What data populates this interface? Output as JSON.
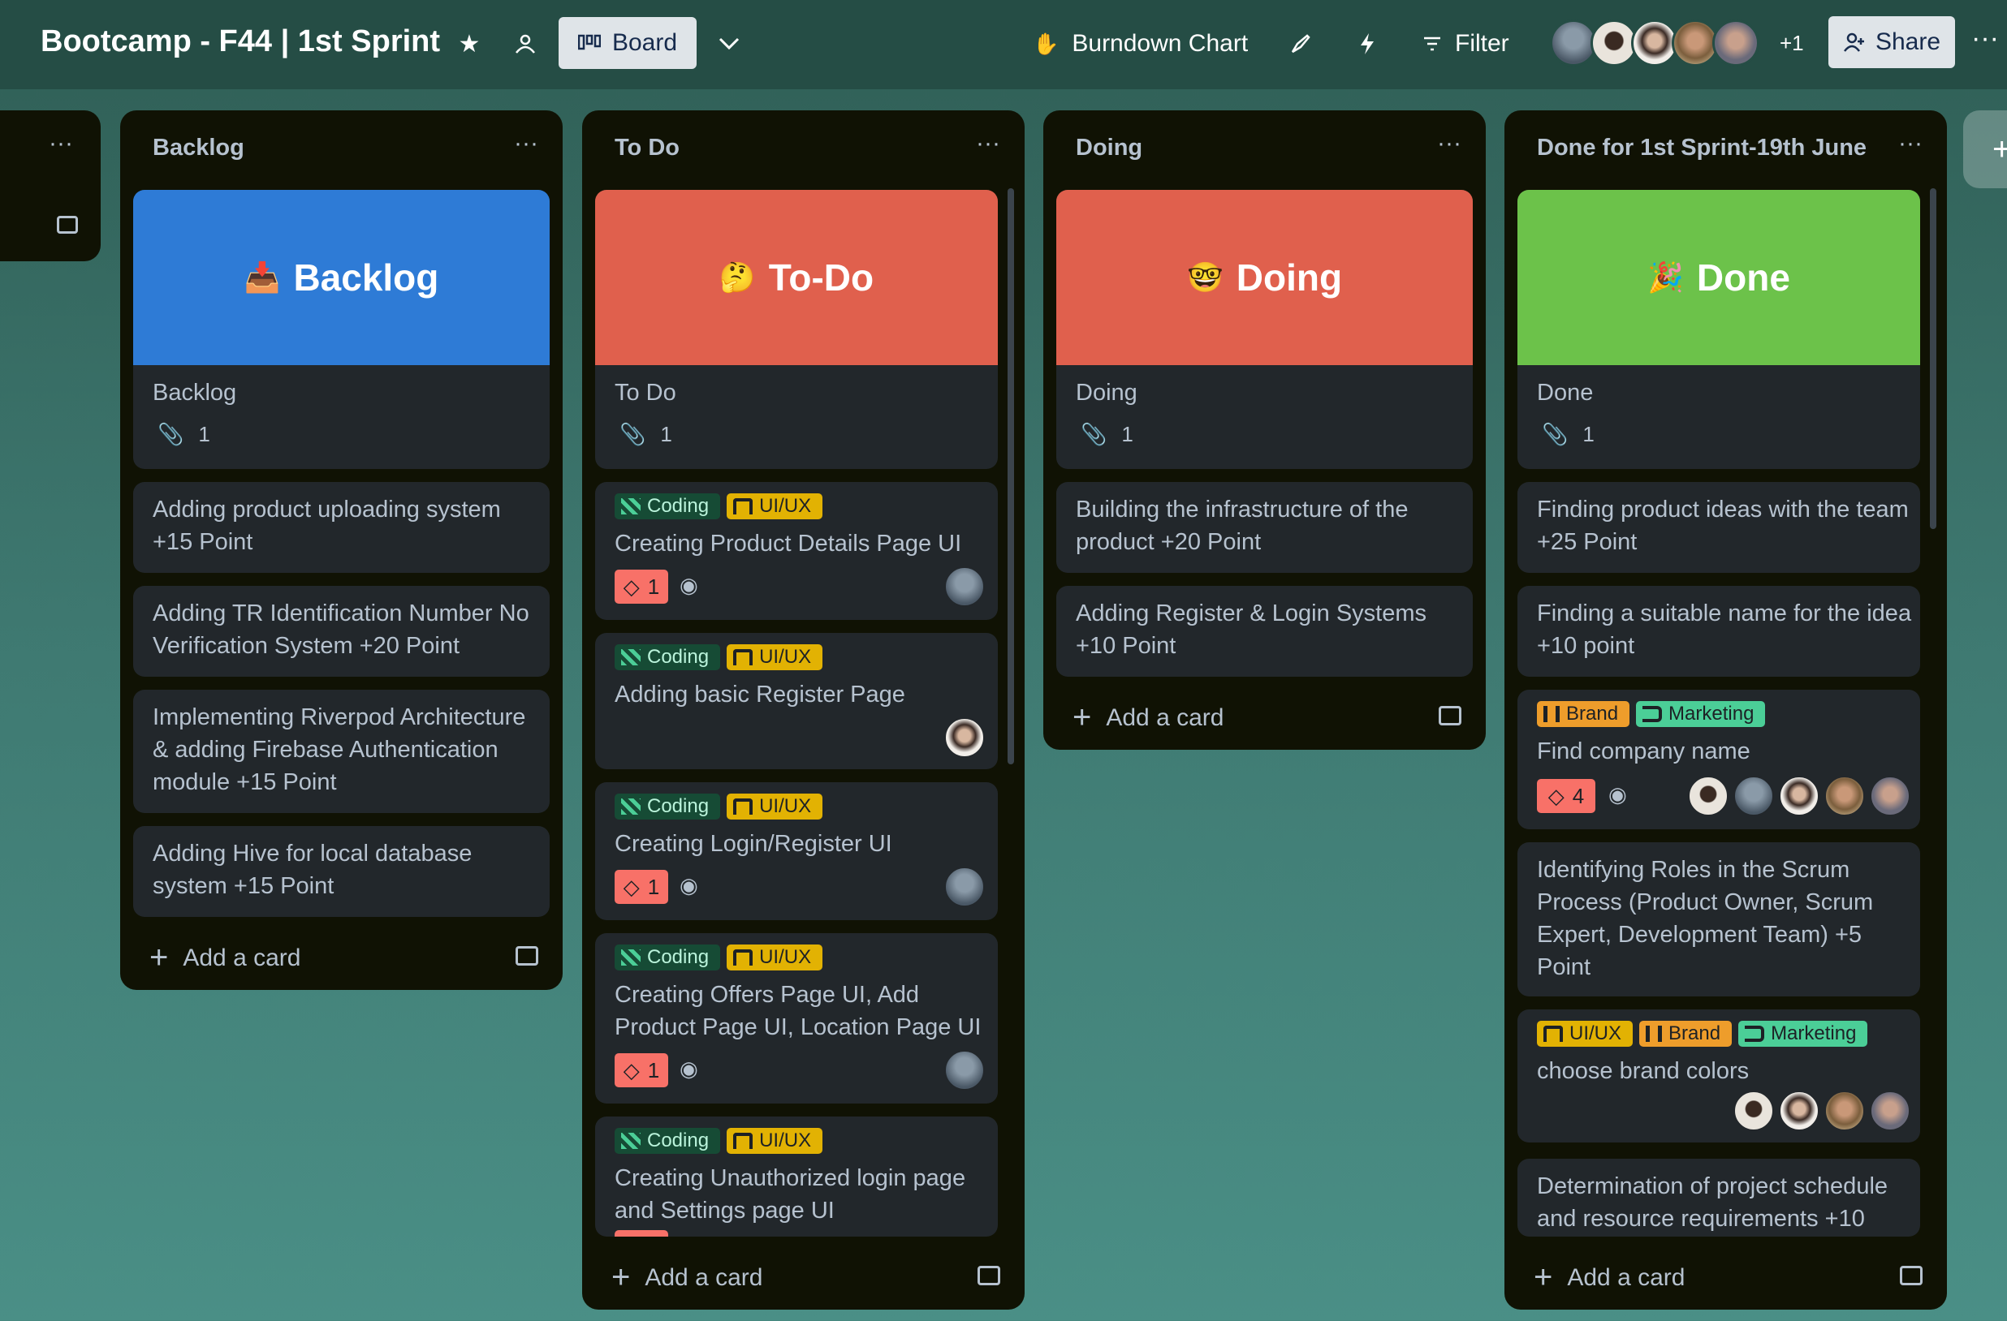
{
  "topbar": {
    "board_title": "Bootcamp - F44 | 1st Sprint",
    "board_view_label": "Board",
    "burndown_label": "Burndown Chart",
    "filter_label": "Filter",
    "extra_members": "+1",
    "share_label": "Share"
  },
  "lists": [
    {
      "title": "Backlog",
      "cover": {
        "emoji": "📥",
        "title": "Backlog",
        "color": "#2e7bd6"
      },
      "cover_card_title": "Backlog",
      "attachments": "1",
      "cards": [
        {
          "text": "Adding product uploading system +15 Point"
        },
        {
          "text": "Adding TR Identification Number No Verification System +20 Point"
        },
        {
          "text": "Implementing Riverpod Architecture & adding Firebase Authentication module +15 Point"
        },
        {
          "text": "Adding Hive for local database system +15 Point"
        }
      ],
      "add_card": "Add a card"
    },
    {
      "title": "To Do",
      "cover": {
        "emoji": "🤔",
        "title": "To-Do",
        "color": "#e0604d"
      },
      "cover_card_title": "To Do",
      "attachments": "1",
      "cards": [
        {
          "labels": [
            "Coding",
            "UI/UX"
          ],
          "text": "Creating Product Details Page UI",
          "badge": "1"
        },
        {
          "labels": [
            "Coding",
            "UI/UX"
          ],
          "text": "Adding basic Register Page"
        },
        {
          "labels": [
            "Coding",
            "UI/UX"
          ],
          "text": "Creating Login/Register UI",
          "badge": "1"
        },
        {
          "labels": [
            "Coding",
            "UI/UX"
          ],
          "text": "Creating Offers Page UI, Add Product Page UI, Location Page UI",
          "badge": "1"
        },
        {
          "labels": [
            "Coding",
            "UI/UX"
          ],
          "text": "Creating Unauthorized login page and Settings page UI"
        }
      ],
      "add_card": "Add a card"
    },
    {
      "title": "Doing",
      "cover": {
        "emoji": "🤓",
        "title": "Doing",
        "color": "#e0604d"
      },
      "cover_card_title": "Doing",
      "attachments": "1",
      "cards": [
        {
          "text": "Building the infrastructure of the product +20 Point"
        },
        {
          "text": "Adding Register & Login Systems +10 Point"
        }
      ],
      "add_card": "Add a card"
    },
    {
      "title": "Done for 1st Sprint-19th June",
      "cover": {
        "emoji": "🎉",
        "title": "Done",
        "color": "#6cc24a"
      },
      "cover_card_title": "Done",
      "attachments": "1",
      "cards": [
        {
          "text": "Finding product ideas with the team +25 Point"
        },
        {
          "text": "Finding a suitable name for the idea +10 point"
        },
        {
          "labels": [
            "Brand",
            "Marketing"
          ],
          "text": "Find company name",
          "badge": "4"
        },
        {
          "text": "Identifying Roles in the Scrum Process (Product Owner, Scrum Expert, Development Team) +5 Point"
        },
        {
          "labels": [
            "UI/UX",
            "Brand",
            "Marketing"
          ],
          "text": "choose brand colors"
        },
        {
          "text": "Determination of project schedule and resource requirements +10"
        }
      ],
      "add_card": "Add a card"
    }
  ],
  "colors": {
    "background": "#3f7a72",
    "list_bg": "#101204",
    "card_bg": "#22272b",
    "label_coding": "#164b35",
    "label_uiux": "#e2b203",
    "label_brand": "#ee9d2b",
    "label_marketing": "#4bce97",
    "badge_red": "#f87168"
  }
}
